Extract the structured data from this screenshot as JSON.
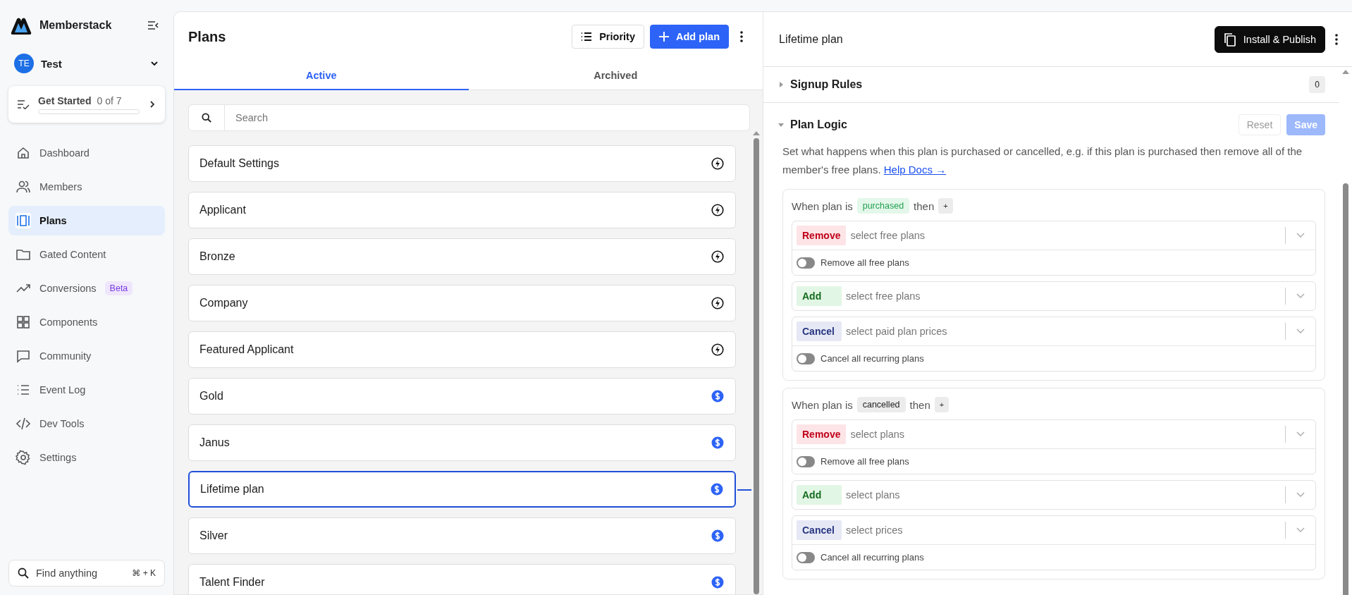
{
  "sidebar": {
    "brand": "Memberstack",
    "workspace": {
      "initials": "TE",
      "name": "Test"
    },
    "get_started": {
      "title": "Get Started",
      "count": "0 of 7",
      "level": 0
    },
    "nav": [
      {
        "label": "Dashboard",
        "selected": false
      },
      {
        "label": "Members",
        "selected": false
      },
      {
        "label": "Plans",
        "selected": true
      },
      {
        "label": "Gated Content",
        "selected": false
      },
      {
        "label": "Conversions",
        "selected": false,
        "badge": "Beta"
      },
      {
        "label": "Components",
        "selected": false
      },
      {
        "label": "Community",
        "selected": false
      },
      {
        "label": "Event Log",
        "selected": false
      },
      {
        "label": "Dev Tools",
        "selected": false
      },
      {
        "label": "Settings",
        "selected": false
      }
    ],
    "search": {
      "placeholder": "Find anything",
      "shortcut": "⌘ + K"
    }
  },
  "plans_panel": {
    "title": "Plans",
    "priority_button": "Priority",
    "add_button": "Add plan",
    "tabs": [
      {
        "label": "Active",
        "selected": true
      },
      {
        "label": "Archived",
        "selected": false
      }
    ],
    "search": {
      "placeholder": "Search"
    },
    "plans": [
      {
        "name": "Default Settings",
        "kind": "free",
        "selected": false
      },
      {
        "name": "Applicant",
        "kind": "free",
        "selected": false
      },
      {
        "name": "Bronze",
        "kind": "free",
        "selected": false
      },
      {
        "name": "Company",
        "kind": "free",
        "selected": false
      },
      {
        "name": "Featured Applicant",
        "kind": "free",
        "selected": false
      },
      {
        "name": "Gold",
        "kind": "paid",
        "selected": false
      },
      {
        "name": "Janus",
        "kind": "paid",
        "selected": false
      },
      {
        "name": "Lifetime plan",
        "kind": "paid",
        "selected": true
      },
      {
        "name": "Silver",
        "kind": "paid",
        "selected": false
      },
      {
        "name": "Talent Finder",
        "kind": "paid",
        "selected": false
      }
    ]
  },
  "detail": {
    "title": "Lifetime plan",
    "install_button": "Install & Publish",
    "signup_rules": {
      "title": "Signup Rules",
      "expanded": false,
      "count": "0"
    },
    "plan_logic": {
      "title": "Plan Logic",
      "expanded": true,
      "reset": "Reset",
      "save": "Save",
      "save_disabled": true,
      "description": "Set what happens when this plan is purchased or cancelled, e.g. if this plan is purchased then remove all of the member's free plans.",
      "help_link": "Help Docs →",
      "blocks": [
        {
          "prefix": "When plan is",
          "event": {
            "label": "purchased",
            "kind": "purchased"
          },
          "suffix": "then",
          "add": "+",
          "rules": [
            {
              "action": {
                "label": "Remove",
                "kind": "remove"
              },
              "placeholder": "select free plans",
              "toggle": {
                "label": "Remove all free plans",
                "on": false
              }
            },
            {
              "action": {
                "label": "Add",
                "kind": "add"
              },
              "placeholder": "select free plans"
            },
            {
              "action": {
                "label": "Cancel",
                "kind": "cancel"
              },
              "placeholder": "select paid plan prices",
              "toggle": {
                "label": "Cancel all recurring plans",
                "on": false
              }
            }
          ]
        },
        {
          "prefix": "When plan is",
          "event": {
            "label": "cancelled",
            "kind": "cancelled"
          },
          "suffix": "then",
          "add": "+",
          "rules": [
            {
              "action": {
                "label": "Remove",
                "kind": "remove"
              },
              "placeholder": "select plans",
              "toggle": {
                "label": "Remove all free plans",
                "on": false
              }
            },
            {
              "action": {
                "label": "Add",
                "kind": "add"
              },
              "placeholder": "select plans"
            },
            {
              "action": {
                "label": "Cancel",
                "kind": "cancel"
              },
              "placeholder": "select prices",
              "toggle": {
                "label": "Cancel all recurring plans",
                "on": false
              }
            }
          ]
        }
      ]
    }
  }
}
